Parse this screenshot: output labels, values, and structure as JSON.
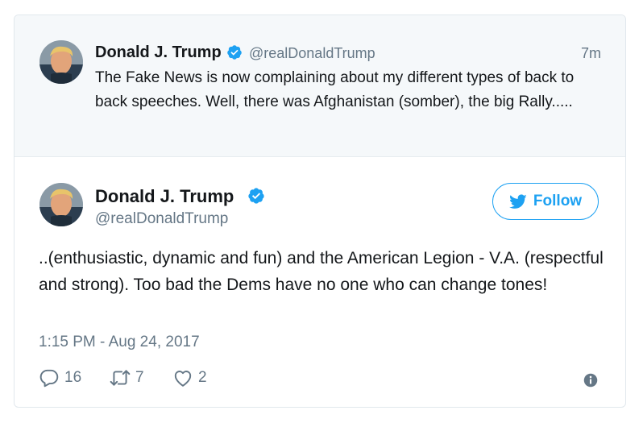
{
  "parent_tweet": {
    "author_name": "Donald J. Trump",
    "handle": "@realDonaldTrump",
    "time_ago": "7m",
    "text": "The Fake News is now complaining about my different types of back to back speeches. Well, there was Afghanistan (somber), the big Rally....."
  },
  "main_tweet": {
    "author_name": "Donald J. Trump",
    "handle": "@realDonaldTrump",
    "follow_label": "Follow",
    "text": "..(enthusiastic, dynamic and fun) and the American Legion - V.A. (respectful and strong). Too bad the Dems have no one who can change tones!",
    "timestamp": "1:15 PM - Aug 24, 2017",
    "stats": {
      "replies": "16",
      "retweets": "7",
      "likes": "2"
    }
  },
  "icons": {
    "verified": "verified-badge-icon",
    "follow": "twitter-bird-icon",
    "reply": "reply-bubble-icon",
    "retweet": "retweet-arrows-icon",
    "like": "heart-outline-icon",
    "info": "info-circle-icon"
  },
  "colors": {
    "brand_blue": "#1da1f2",
    "verified_blue": "#1da1f2",
    "muted_text": "#657786",
    "parent_background": "#f5f8fa",
    "border": "#e1e8ed"
  }
}
